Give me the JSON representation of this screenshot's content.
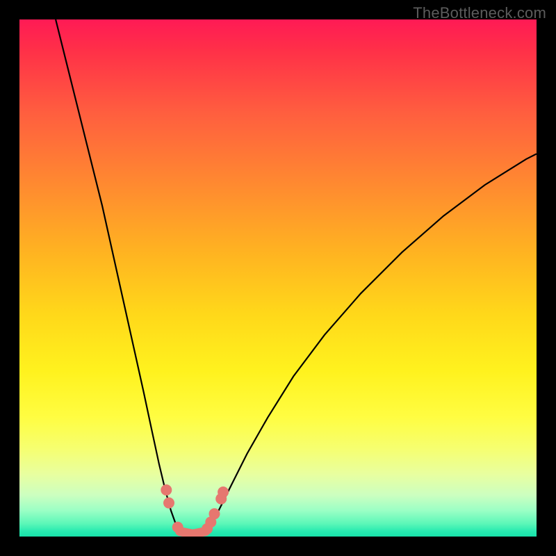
{
  "watermark": "TheBottleneck.com",
  "chart_data": {
    "type": "line",
    "title": "",
    "xlabel": "",
    "ylabel": "",
    "xlim": [
      0,
      100
    ],
    "ylim": [
      0,
      100
    ],
    "grid": false,
    "legend": false,
    "series": [
      {
        "name": "left-curve",
        "x": [
          7,
          10,
          13,
          16,
          18,
          20,
          22,
          24,
          25.5,
          27,
          28.2,
          29.3,
          30.2,
          31
        ],
        "y": [
          100,
          88,
          76,
          64,
          55,
          46,
          37,
          28,
          21,
          14,
          9,
          5,
          2.5,
          1
        ]
      },
      {
        "name": "right-curve",
        "x": [
          36,
          37.5,
          39,
          41,
          44,
          48,
          53,
          59,
          66,
          74,
          82,
          90,
          98,
          100
        ],
        "y": [
          1,
          3,
          6,
          10,
          16,
          23,
          31,
          39,
          47,
          55,
          62,
          68,
          73,
          74
        ]
      },
      {
        "name": "valley-floor",
        "x": [
          31,
          33.5,
          36
        ],
        "y": [
          1,
          0.5,
          1
        ]
      }
    ],
    "markers": [
      {
        "series": "left-curve",
        "x": 28.4,
        "y": 9.0
      },
      {
        "series": "left-curve",
        "x": 28.9,
        "y": 6.5
      },
      {
        "series": "left-curve",
        "x": 30.6,
        "y": 1.8
      },
      {
        "series": "right-curve",
        "x": 36.3,
        "y": 1.5
      },
      {
        "series": "right-curve",
        "x": 37.0,
        "y": 2.8
      },
      {
        "series": "right-curve",
        "x": 37.7,
        "y": 4.4
      },
      {
        "series": "right-curve",
        "x": 39.0,
        "y": 7.3
      },
      {
        "series": "right-curve",
        "x": 39.4,
        "y": 8.6
      }
    ],
    "colors": {
      "curve": "#000000",
      "marker": "#e6776f",
      "gradient_top": "#ff1a55",
      "gradient_mid": "#fff21e",
      "gradient_bottom": "#18e2aa",
      "frame": "#000000"
    }
  }
}
